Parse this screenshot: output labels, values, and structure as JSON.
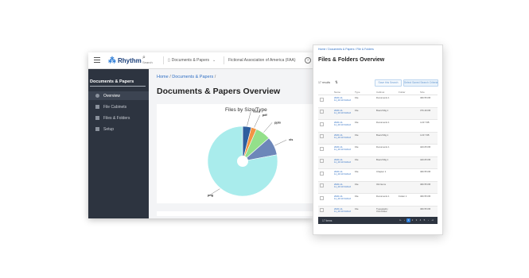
{
  "app": {
    "logo_mark": "⁂",
    "logo_text": "Rhythm"
  },
  "topbar": {
    "search_label": "Search",
    "section_label": "Documents & Papers",
    "org_label": "Fictional Association of America (FAA)",
    "help_glyph": "?"
  },
  "sidebar": {
    "title": "Documents & Papers",
    "items": [
      {
        "label": "Overview",
        "icon": "overview-icon",
        "active": true
      },
      {
        "label": "File Cabinets",
        "icon": "cabinet-icon",
        "active": false
      },
      {
        "label": "Files & Folders",
        "icon": "list-icon",
        "active": false
      },
      {
        "label": "Setup",
        "icon": "setup-icon",
        "active": false
      }
    ]
  },
  "main": {
    "breadcrumb": {
      "home": "Home",
      "section": "Documents & Papers"
    },
    "title": "Documents & Papers Overview"
  },
  "chart_data": {
    "type": "pie",
    "title": "Files by Size/Type",
    "slices": [
      {
        "label": "docx",
        "value": 4,
        "color": "#2e5e9e"
      },
      {
        "label": "pdf",
        "value": 2.5,
        "color": "#f29544"
      },
      {
        "label": "pptx",
        "value": 7,
        "color": "#93e08a"
      },
      {
        "label": "xls",
        "value": 8.5,
        "color": "#6d87b9"
      },
      {
        "label": "png",
        "value": 78,
        "color": "#a9ecec"
      }
    ]
  },
  "front": {
    "breadcrumb": "Home / Documents & Papers / File & Folders",
    "title": "Files & Folders Overview",
    "results": "17 results",
    "sort_icon": "⇅",
    "search_button": "Save this Search",
    "saved_button": "Select Saved Search Criteria",
    "columns": [
      "Name",
      "Type",
      "Cabinet",
      "Folder",
      "Size"
    ],
    "rows": [
      {
        "name": "2020-14-11_20:13 FLDHJ",
        "type": "File",
        "cabinet": "Documents 1",
        "folder": "",
        "size": "496.55 KB"
      },
      {
        "name": "2020-14-11_20:13 FLDHJ",
        "type": "File",
        "cabinet": "Board Mtg 1",
        "folder": "",
        "size": "376.49 KB"
      },
      {
        "name": "2020-14-11_20:13 FLDHJ",
        "type": "File",
        "cabinet": "Documents 1",
        "folder": "",
        "size": "4.217 KB"
      },
      {
        "name": "2020-14-11_20:13 FLDHJ",
        "type": "File",
        "cabinet": "Board Mtg 1",
        "folder": "",
        "size": "4.217 KB"
      },
      {
        "name": "2020-14-11_20:13 FLDHJ",
        "type": "File",
        "cabinet": "Documents 1",
        "folder": "",
        "size": "420.05 KB"
      },
      {
        "name": "2020-14-11_20:13 FLDHJ",
        "type": "File",
        "cabinet": "Board Mtg 1",
        "folder": "",
        "size": "440.05 KB"
      },
      {
        "name": "2020-14-11_20:13 FLDHJ",
        "type": "File",
        "cabinet": "Chapter 1",
        "folder": "",
        "size": "496.55 KB"
      },
      {
        "name": "2020-14-11_20:13 FLDHJ",
        "type": "File",
        "cabinet": "Old Items",
        "folder": "",
        "size": "496.55 KB"
      },
      {
        "name": "2020-14-11_20:13 FLDHJ",
        "type": "File",
        "cabinet": "Documents 1",
        "folder": "Folder 1",
        "size": "496.55 KB"
      },
      {
        "name": "2020-14-11_20:13 FLDHJ",
        "type": "File",
        "cabinet": "Typography Committee",
        "folder": "",
        "size": "496.55 KB"
      }
    ],
    "pager": {
      "count": "17 items",
      "pages": [
        "⇤",
        "‹",
        "1",
        "2",
        "3",
        "4",
        "5",
        "›",
        "⇥"
      ],
      "current": "1"
    }
  }
}
